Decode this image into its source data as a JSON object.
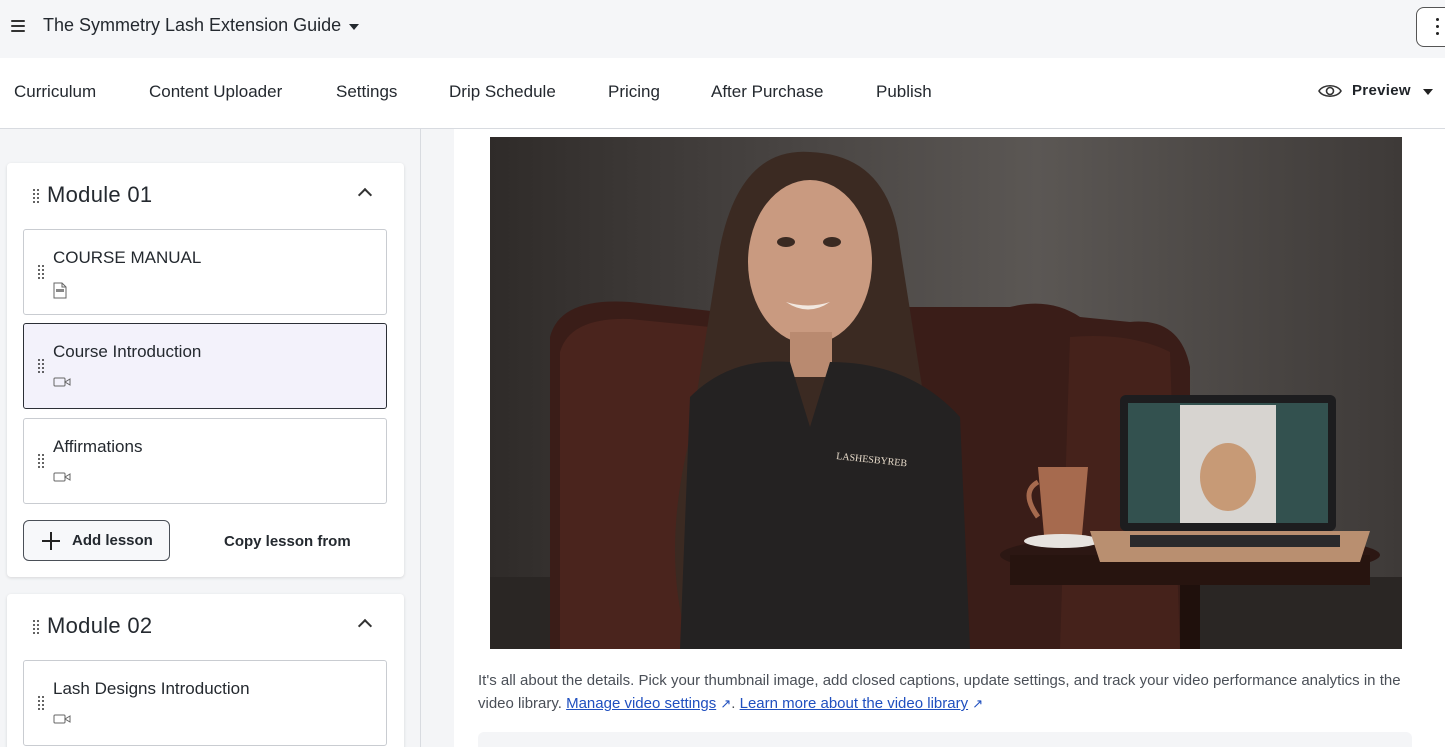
{
  "header": {
    "course_title": "The Symmetry Lash Extension Guide"
  },
  "tabs": [
    {
      "label": "Curriculum"
    },
    {
      "label": "Content Uploader"
    },
    {
      "label": "Settings"
    },
    {
      "label": "Drip Schedule"
    },
    {
      "label": "Pricing"
    },
    {
      "label": "After Purchase"
    },
    {
      "label": "Publish"
    }
  ],
  "preview": {
    "label": "Preview"
  },
  "modules": [
    {
      "title": "Module 01",
      "lessons": [
        {
          "title": "COURSE MANUAL",
          "icon": "pdf-icon",
          "selected": false
        },
        {
          "title": "Course Introduction",
          "icon": "video-icon",
          "selected": true
        },
        {
          "title": "Affirmations",
          "icon": "video-icon",
          "selected": false
        }
      ],
      "add_lesson_label": "Add lesson",
      "copy_lesson_label": "Copy lesson from"
    },
    {
      "title": "Module 02",
      "lessons": [
        {
          "title": "Lash Designs Introduction",
          "icon": "video-icon",
          "selected": false
        }
      ]
    }
  ],
  "video_section": {
    "thumbnail_shirt_text": "LASHESBYREB",
    "description": "It's all about the details. Pick your thumbnail image, add closed captions, update settings, and track your video performance analytics in the video library.",
    "manage_link": "Manage video settings",
    "learn_link": "Learn more about the video library",
    "separator": "."
  },
  "colors": {
    "link": "#1f4fbf",
    "selected_lesson_bg": "#f3f2fb"
  }
}
